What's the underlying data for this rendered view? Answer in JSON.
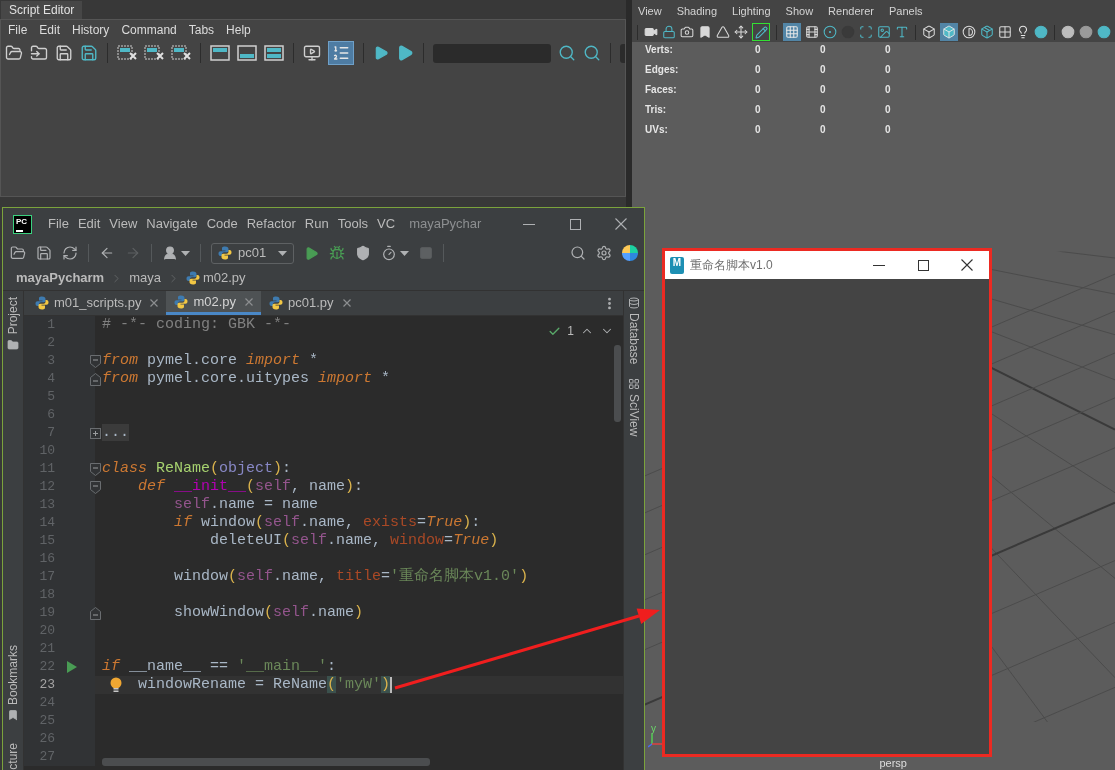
{
  "script_editor": {
    "tab": "Script Editor",
    "menu": [
      "File",
      "Edit",
      "History",
      "Command",
      "Tabs",
      "Help"
    ],
    "line_numbers_on": true
  },
  "viewport": {
    "menu": [
      "View",
      "Shading",
      "Lighting",
      "Show",
      "Renderer",
      "Panels"
    ],
    "pencil_active": true,
    "grid_on": true,
    "smooth_shade_on": true,
    "stats": [
      {
        "label": "Verts:",
        "values": [
          "0",
          "0",
          "0"
        ]
      },
      {
        "label": "Edges:",
        "values": [
          "0",
          "0",
          "0"
        ]
      },
      {
        "label": "Faces:",
        "values": [
          "0",
          "0",
          "0"
        ]
      },
      {
        "label": "Tris:",
        "values": [
          "0",
          "0",
          "0"
        ]
      },
      {
        "label": "UVs:",
        "values": [
          "0",
          "0",
          "0"
        ]
      }
    ],
    "axis_label": "y",
    "camera": "persp"
  },
  "ide": {
    "logo": "PC",
    "menu": [
      "File",
      "Edit",
      "View",
      "Navigate",
      "Code",
      "Refactor",
      "Run",
      "Tools",
      "VC"
    ],
    "title": "mayaPychar",
    "run_config": "pc01",
    "breadcrumbs": [
      "mayaPycharm",
      "maya",
      "m02.py"
    ],
    "tabs": [
      {
        "label": "m01_scripts.py",
        "selected": false
      },
      {
        "label": "m02.py",
        "selected": true
      },
      {
        "label": "pc01.py",
        "selected": false
      }
    ],
    "left_tools": {
      "top": [
        "Project"
      ],
      "bottom": [
        "Bookmarks",
        "cture"
      ]
    },
    "right_tools": [
      "Database",
      "SciView"
    ],
    "inspection_count": "1",
    "lines": [
      {
        "number": "1",
        "kind": "plain",
        "current": false,
        "tokens": [
          {
            "kind": "comment",
            "text": "# -*- coding: GBK -*-"
          }
        ]
      },
      {
        "number": "2",
        "kind": "plain",
        "current": false
      },
      {
        "number": "3",
        "kind": "foldstart",
        "current": false,
        "tokens": [
          {
            "kind": "keyword",
            "text": "from"
          },
          {
            "kind": "plain",
            "text": " pymel.core "
          },
          {
            "kind": "keyword",
            "text": "import"
          },
          {
            "kind": "plain",
            "text": " *"
          }
        ]
      },
      {
        "number": "4",
        "kind": "foldend",
        "current": false,
        "tokens": [
          {
            "kind": "keyword",
            "text": "from"
          },
          {
            "kind": "plain",
            "text": " pymel.core.uitypes "
          },
          {
            "kind": "keyword",
            "text": "import"
          },
          {
            "kind": "plain",
            "text": " *"
          }
        ]
      },
      {
        "number": "5",
        "kind": "plain",
        "current": false
      },
      {
        "number": "6",
        "kind": "plain",
        "current": false
      },
      {
        "number": "7",
        "kind": "folded",
        "current": false,
        "tokens": [
          {
            "kind": "folded",
            "text": "..."
          }
        ]
      },
      {
        "number": "10",
        "kind": "plain",
        "current": false
      },
      {
        "number": "11",
        "kind": "foldstart",
        "current": false,
        "tokens": [
          {
            "kind": "keyword",
            "text": "class "
          },
          {
            "kind": "class_name",
            "text": "ReName"
          },
          {
            "kind": "paren",
            "text": "("
          },
          {
            "kind": "builtin",
            "text": "object"
          },
          {
            "kind": "paren",
            "text": ")"
          },
          {
            "kind": "plain",
            "text": ":"
          }
        ]
      },
      {
        "number": "12",
        "kind": "foldstart",
        "current": false,
        "tokens": [
          {
            "kind": "keyword",
            "text": "    def "
          },
          {
            "kind": "magic",
            "text": "__init__"
          },
          {
            "kind": "paren",
            "text": "("
          },
          {
            "kind": "self",
            "text": "self"
          },
          {
            "kind": "plain",
            "text": ", name"
          },
          {
            "kind": "paren",
            "text": ")"
          },
          {
            "kind": "plain",
            "text": ":"
          }
        ]
      },
      {
        "number": "13",
        "kind": "plain",
        "current": false,
        "tokens": [
          {
            "kind": "self",
            "text": "        self"
          },
          {
            "kind": "plain",
            "text": ".name = name"
          }
        ]
      },
      {
        "number": "14",
        "kind": "plain",
        "current": false,
        "tokens": [
          {
            "kind": "keyword",
            "text": "        if"
          },
          {
            "kind": "plain",
            "text": " window"
          },
          {
            "kind": "paren",
            "text": "("
          },
          {
            "kind": "self",
            "text": "self"
          },
          {
            "kind": "plain",
            "text": ".name, "
          },
          {
            "kind": "named_arg",
            "text": "exists"
          },
          {
            "kind": "plain",
            "text": "="
          },
          {
            "kind": "keyword",
            "text": "True"
          },
          {
            "kind": "paren",
            "text": ")"
          },
          {
            "kind": "plain",
            "text": ":"
          }
        ]
      },
      {
        "number": "15",
        "kind": "plain",
        "current": false,
        "tokens": [
          {
            "kind": "plain",
            "text": "            deleteUI"
          },
          {
            "kind": "paren",
            "text": "("
          },
          {
            "kind": "self",
            "text": "self"
          },
          {
            "kind": "plain",
            "text": ".name, "
          },
          {
            "kind": "named_arg",
            "text": "window"
          },
          {
            "kind": "plain",
            "text": "="
          },
          {
            "kind": "keyword",
            "text": "True"
          },
          {
            "kind": "paren",
            "text": ")"
          }
        ]
      },
      {
        "number": "16",
        "kind": "plain",
        "current": false
      },
      {
        "number": "17",
        "kind": "plain",
        "current": false,
        "tokens": [
          {
            "kind": "plain",
            "text": "        window"
          },
          {
            "kind": "paren",
            "text": "("
          },
          {
            "kind": "self",
            "text": "self"
          },
          {
            "kind": "plain",
            "text": ".name, "
          },
          {
            "kind": "named_arg",
            "text": "title"
          },
          {
            "kind": "plain",
            "text": "="
          },
          {
            "kind": "string",
            "text": "'重命名脚本v1.0'"
          },
          {
            "kind": "paren",
            "text": ")"
          }
        ]
      },
      {
        "number": "18",
        "kind": "plain",
        "current": false
      },
      {
        "number": "19",
        "kind": "foldend",
        "current": false,
        "tokens": [
          {
            "kind": "plain",
            "text": "        showWindow"
          },
          {
            "kind": "paren",
            "text": "("
          },
          {
            "kind": "self",
            "text": "self"
          },
          {
            "kind": "plain",
            "text": ".name"
          },
          {
            "kind": "paren",
            "text": ")"
          }
        ]
      },
      {
        "number": "20",
        "kind": "plain",
        "current": false
      },
      {
        "number": "21",
        "kind": "plain",
        "current": false
      },
      {
        "number": "22",
        "kind": "runnable",
        "current": false,
        "tokens": [
          {
            "kind": "keyword",
            "text": "if"
          },
          {
            "kind": "plain",
            "text": " __name__ == "
          },
          {
            "kind": "string",
            "text": "'__main__'"
          },
          {
            "kind": "plain",
            "text": ":"
          }
        ]
      },
      {
        "number": "23",
        "kind": "hint",
        "current": true,
        "caret": true,
        "tokens": [
          {
            "kind": "plain",
            "text": "    windowRename = ReName"
          },
          {
            "kind": "paren_match",
            "text": "("
          },
          {
            "kind": "string",
            "text": "'myW'"
          },
          {
            "kind": "paren_match",
            "text": ")"
          }
        ]
      },
      {
        "number": "24",
        "kind": "plain",
        "current": false
      },
      {
        "number": "25",
        "kind": "plain",
        "current": false
      },
      {
        "number": "26",
        "kind": "plain",
        "current": false
      },
      {
        "number": "27",
        "kind": "plain",
        "current": false
      }
    ]
  },
  "dialog": {
    "logo": "M",
    "title": "重命名脚本v1.0"
  }
}
